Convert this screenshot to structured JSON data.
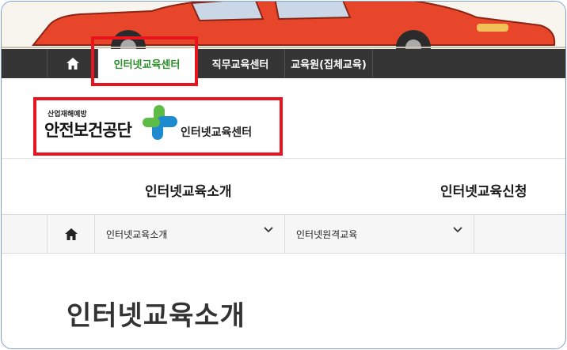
{
  "top_nav": {
    "home_icon": "home-icon",
    "items": [
      {
        "label": "인터넷교육센터",
        "active": true
      },
      {
        "label": "직무교육센터",
        "active": false
      },
      {
        "label": "교육원(집체교육)",
        "active": false
      }
    ]
  },
  "logo": {
    "small_text": "산업재해예방",
    "org_name": "안전보건공단",
    "center_name": "인터넷교육센터"
  },
  "main_menu": [
    "인터넷교육소개",
    "인터넷교육신청"
  ],
  "breadcrumb": {
    "home_icon": "home-icon",
    "level1": "인터넷교육소개",
    "level2": "인터넷원격교육"
  },
  "page_title": "인터넷교육소개",
  "colors": {
    "nav_bg": "#353535",
    "active_green": "#2c8d2a",
    "highlight_red": "#e8141e",
    "car_red": "#e8462a",
    "logo_blue": "#1e8bd0",
    "logo_green": "#5dbb46"
  }
}
